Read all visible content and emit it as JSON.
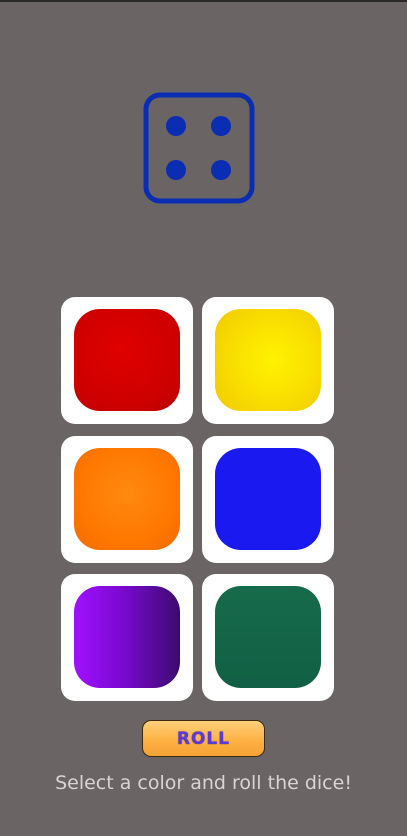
{
  "dice": {
    "face_value": 4,
    "icon": "dice-four-icon",
    "color": "#0a2db4"
  },
  "colors": [
    {
      "name": "red",
      "fill": "#d40000"
    },
    {
      "name": "yellow",
      "fill": "#f7dc00"
    },
    {
      "name": "orange",
      "fill": "#ff7a00"
    },
    {
      "name": "blue",
      "fill": "#1a1af0"
    },
    {
      "name": "purple",
      "fill": "#8a0fd8"
    },
    {
      "name": "green",
      "fill": "#136647"
    }
  ],
  "roll_button": {
    "label": "ROLL"
  },
  "hint": {
    "text": "Select a color and roll the dice!"
  }
}
